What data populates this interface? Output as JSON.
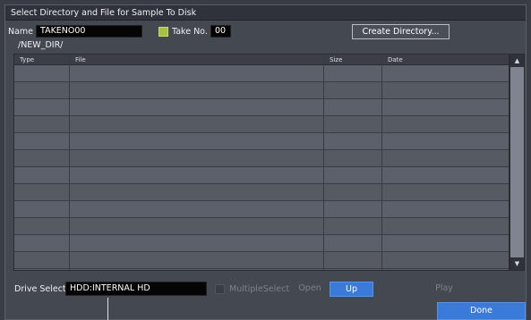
{
  "dialog": {
    "title": "Select Directory and File for Sample To Disk"
  },
  "name_row": {
    "name_label": "Name",
    "name_value": "TAKENO00",
    "take_no_label": "Take No.",
    "take_no_checked": true,
    "take_no_value": "00",
    "create_dir_label": "Create Directory..."
  },
  "path": "/NEW_DIR/",
  "file_table": {
    "columns": [
      "Type",
      "File",
      "Size",
      "Date"
    ],
    "rows": [],
    "visible_row_count": 12
  },
  "scrollbar": {
    "up_icon": "▲",
    "down_icon": "▼"
  },
  "bottom": {
    "drive_label": "Drive Select",
    "drive_value": "HDD:INTERNAL HD",
    "multiple_select_label": "MultipleSelect",
    "multiple_select_checked": false,
    "open_label": "Open",
    "up_label": "Up",
    "play_label": "Play",
    "done_label": "Done"
  },
  "colors": {
    "accent_blue": "#3a7ad8",
    "checkbox_green": "#a8c040",
    "background": "#444851"
  }
}
